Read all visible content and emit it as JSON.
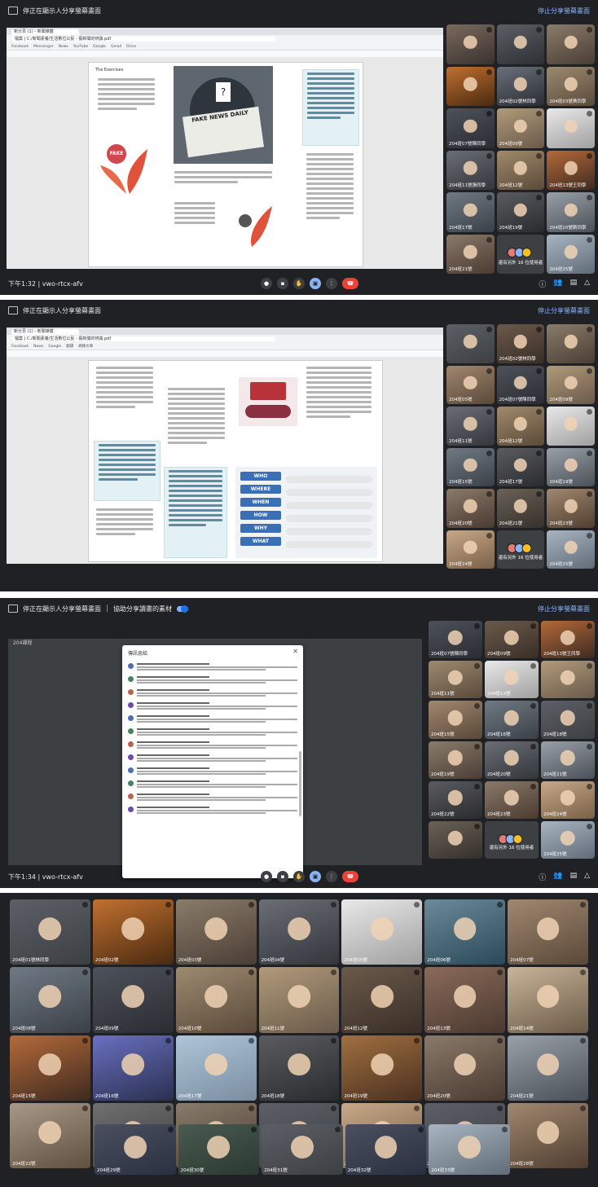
{
  "meeting": {
    "title": "停正在顯示人分享螢幕畫面",
    "present_label": "停止分享螢幕畫面",
    "breakout_title": "協助分享讀書的素材",
    "code": "vwo-rtcx-afv",
    "times": [
      "下午1:32",
      "下午1:33",
      "下午1:34",
      "下午1:34"
    ],
    "more_label": "還有另外 16 位使用者"
  },
  "browser": {
    "tab_label": "新分頁 (1) - 新聞媒體",
    "url": "檔案 | C:/新聞素養/生活數位公民 - 假新聞的辨識.pdf",
    "bookmarks": [
      "Facebook",
      "Messenger",
      "News",
      "YouTube",
      "Google",
      "Gmail",
      "Drive",
      "翻譯",
      "網路文章"
    ]
  },
  "pdf": {
    "page1_heading": "The Exercises",
    "fake_news_headline": "FAKE NEWS DAILY",
    "fake_badge": "FAKE",
    "wh_words": [
      "WHO",
      "WHERE",
      "WHEN",
      "HOW",
      "WHY",
      "WHAT"
    ]
  },
  "breakout": {
    "room_name": "204課程",
    "dialog_title": "傳訊息給"
  },
  "panel1_tiles": [
    {
      "label": "",
      "c1": "#7a6a5a",
      "c2": "#3a3230"
    },
    {
      "label": "",
      "c1": "#5c6066",
      "c2": "#2c3035"
    },
    {
      "label": "",
      "c1": "#8a7c6a",
      "c2": "#4a3e35"
    },
    {
      "label": "",
      "c1": "#c07030",
      "c2": "#4a2a10"
    },
    {
      "label": "204班02號林同學",
      "c1": "#6a707a",
      "c2": "#2a2e33"
    },
    {
      "label": "204班03號黃同學",
      "c1": "#9c8a70",
      "c2": "#5a4a3a"
    },
    {
      "label": "204班07號陳同學",
      "c1": "#4d5159",
      "c2": "#2a2d33"
    },
    {
      "label": "204班09號",
      "c1": "#b09a7a",
      "c2": "#6a5a4a"
    },
    {
      "label": "",
      "c1": "#e8e8e8",
      "c2": "#a0a0a0"
    },
    {
      "label": "204班11號張同學",
      "c1": "#6a6e75",
      "c2": "#33363b"
    },
    {
      "label": "204班12號",
      "c1": "#a08a6c",
      "c2": "#5a4a38"
    },
    {
      "label": "204班13號王同學",
      "c1": "#b46a3a",
      "c2": "#3e2a20"
    },
    {
      "label": "204班17號",
      "c1": "#707a84",
      "c2": "#3a4048"
    },
    {
      "label": "204班19號",
      "c1": "#5a5c60",
      "c2": "#2a2b2e"
    },
    {
      "label": "204班20號劉同學",
      "c1": "#9aa0a8",
      "c2": "#4a5058"
    },
    {
      "label": "204班21號",
      "c1": "#8a7a6a",
      "c2": "#4a3a30"
    },
    {
      "label": "more",
      "c1": "#3c4043",
      "c2": "#3c4043"
    },
    {
      "label": "204班25號",
      "c1": "#a8b4c0",
      "c2": "#606c78"
    }
  ],
  "panel2_tiles": [
    {
      "label": "",
      "c1": "#5c5f66",
      "c2": "#3c4043"
    },
    {
      "label": "204班02號林同學",
      "c1": "#6a5a4a",
      "c2": "#3a2e26"
    },
    {
      "label": "",
      "c1": "#8a7c6a",
      "c2": "#4a3e35"
    },
    {
      "label": "204班05號",
      "c1": "#a08870",
      "c2": "#5a4838"
    },
    {
      "label": "204班07號陳同學",
      "c1": "#4d5159",
      "c2": "#2a2d33"
    },
    {
      "label": "204班09號",
      "c1": "#b09a7a",
      "c2": "#6a5a4a"
    },
    {
      "label": "204班11號",
      "c1": "#6a6e75",
      "c2": "#33363b"
    },
    {
      "label": "204班12號",
      "c1": "#a08a6c",
      "c2": "#5a4a38"
    },
    {
      "label": "",
      "c1": "#e8e8e8",
      "c2": "#a0a0a0"
    },
    {
      "label": "204班15號",
      "c1": "#707a84",
      "c2": "#3a4048"
    },
    {
      "label": "204班17號",
      "c1": "#5a5c60",
      "c2": "#2a2b2e"
    },
    {
      "label": "204班19號",
      "c1": "#9aa0a8",
      "c2": "#4a5058"
    },
    {
      "label": "204班20號",
      "c1": "#8a7a6a",
      "c2": "#4a3a30"
    },
    {
      "label": "204班21號",
      "c1": "#6a6258",
      "c2": "#35302a"
    },
    {
      "label": "204班23號",
      "c1": "#a08870",
      "c2": "#503e30"
    },
    {
      "label": "204班24號",
      "c1": "#c8a888",
      "c2": "#786048"
    },
    {
      "label": "more",
      "c1": "#3c4043",
      "c2": "#3c4043"
    },
    {
      "label": "204班25號",
      "c1": "#a8b4c0",
      "c2": "#606c78"
    }
  ],
  "panel3_tiles": [
    {
      "label": "204班07號陳同學",
      "c1": "#4d5159",
      "c2": "#2a2d33"
    },
    {
      "label": "204班09號",
      "c1": "#6a5a4a",
      "c2": "#3a2e26"
    },
    {
      "label": "204班13號王同學",
      "c1": "#b46a3a",
      "c2": "#3e2a20"
    },
    {
      "label": "204班11號",
      "c1": "#9c8a70",
      "c2": "#5a4a3a"
    },
    {
      "label": "204班12號",
      "c1": "#e8e8e8",
      "c2": "#a0a0a0"
    },
    {
      "label": "",
      "c1": "#b09a7a",
      "c2": "#6a5a4a"
    },
    {
      "label": "204班15號",
      "c1": "#a08870",
      "c2": "#5a4838"
    },
    {
      "label": "204班16號",
      "c1": "#707a84",
      "c2": "#3a4048"
    },
    {
      "label": "204班18號",
      "c1": "#5c5f66",
      "c2": "#3c4043"
    },
    {
      "label": "204班19號",
      "c1": "#8a7c6a",
      "c2": "#4a3e35"
    },
    {
      "label": "204班20號",
      "c1": "#6a6e75",
      "c2": "#33363b"
    },
    {
      "label": "204班21號",
      "c1": "#9aa0a8",
      "c2": "#4a5058"
    },
    {
      "label": "204班22號",
      "c1": "#5a5c60",
      "c2": "#2a2b2e"
    },
    {
      "label": "204班23號",
      "c1": "#8a7a6a",
      "c2": "#4a3a30"
    },
    {
      "label": "204班24號",
      "c1": "#c8a888",
      "c2": "#786048"
    },
    {
      "label": "",
      "c1": "#6a6258",
      "c2": "#35302a"
    },
    {
      "label": "more",
      "c1": "#3c4043",
      "c2": "#3c4043"
    },
    {
      "label": "204班25號",
      "c1": "#a8b4c0",
      "c2": "#606c78"
    }
  ],
  "panel4_tiles": [
    {
      "label": "204班01號林同學",
      "c1": "#5c5f66",
      "c2": "#3c4043"
    },
    {
      "label": "204班02號",
      "c1": "#c07030",
      "c2": "#4a2a10"
    },
    {
      "label": "204班03號",
      "c1": "#8a7c6a",
      "c2": "#4a3e35"
    },
    {
      "label": "204班04號",
      "c1": "#6a6e75",
      "c2": "#33363b"
    },
    {
      "label": "204班05號",
      "c1": "#e8e8e8",
      "c2": "#a0a0a0"
    },
    {
      "label": "204班06號",
      "c1": "#6a8a9a",
      "c2": "#2a4a5a"
    },
    {
      "label": "204班07號",
      "c1": "#a08870",
      "c2": "#5a4838"
    },
    {
      "label": "204班08號",
      "c1": "#707a84",
      "c2": "#3a4048"
    },
    {
      "label": "204班09號",
      "c1": "#4d5159",
      "c2": "#2a2d33"
    },
    {
      "label": "204班10號",
      "c1": "#9c8a70",
      "c2": "#5a4a3a"
    },
    {
      "label": "204班11號",
      "c1": "#b09a7a",
      "c2": "#6a5a4a"
    },
    {
      "label": "204班12號",
      "c1": "#6a5a4a",
      "c2": "#3a2e26"
    },
    {
      "label": "204班13號",
      "c1": "#8a6a5a",
      "c2": "#4a3a30"
    },
    {
      "label": "204班14號",
      "c1": "#c8b498",
      "c2": "#6a5a48"
    },
    {
      "label": "204班15號",
      "c1": "#b46a3a",
      "c2": "#3e2a20"
    },
    {
      "label": "204班16號",
      "c1": "#6a70c0",
      "c2": "#2a3050"
    },
    {
      "label": "204班17號",
      "c1": "#b0c4d8",
      "c2": "#7a8ea0"
    },
    {
      "label": "204班18號",
      "c1": "#5a5c60",
      "c2": "#2a2b2e"
    },
    {
      "label": "204班19號",
      "c1": "#a07040",
      "c2": "#4a3020"
    },
    {
      "label": "204班20號",
      "c1": "#8a7a6a",
      "c2": "#4a3a30"
    },
    {
      "label": "204班21號",
      "c1": "#9aa0a8",
      "c2": "#4a5058"
    },
    {
      "label": "204班22號",
      "c1": "#a89888",
      "c2": "#605040"
    },
    {
      "label": "204班23號",
      "c1": "#707070",
      "c2": "#404040"
    },
    {
      "label": "204班24號",
      "c1": "#8a7c6a",
      "c2": "#4a3e35"
    },
    {
      "label": "204班25號",
      "c1": "#5c5f66",
      "c2": "#3c4043"
    },
    {
      "label": "204班26號",
      "c1": "#c8a888",
      "c2": "#786048"
    },
    {
      "label": "204班27號",
      "c1": "#5c5f66",
      "c2": "#3c4043"
    },
    {
      "label": "204班28號",
      "c1": "#a08870",
      "c2": "#503e30"
    },
    {
      "label": "204班29號",
      "c1": "#4a5060",
      "c2": "#2a3040"
    },
    {
      "label": "204班30號",
      "c1": "#4a5a50",
      "c2": "#2a3a30"
    },
    {
      "label": "204班31號",
      "c1": "#5c5f66",
      "c2": "#3c4043"
    },
    {
      "label": "204班32號",
      "c1": "#4a5060",
      "c2": "#2a3040"
    },
    {
      "label": "204班33號",
      "c1": "#a8b4c0",
      "c2": "#606c78"
    }
  ],
  "colors": {
    "meet_bg": "#202124",
    "end_call": "#ea4335",
    "present": "#8ab4f8"
  }
}
